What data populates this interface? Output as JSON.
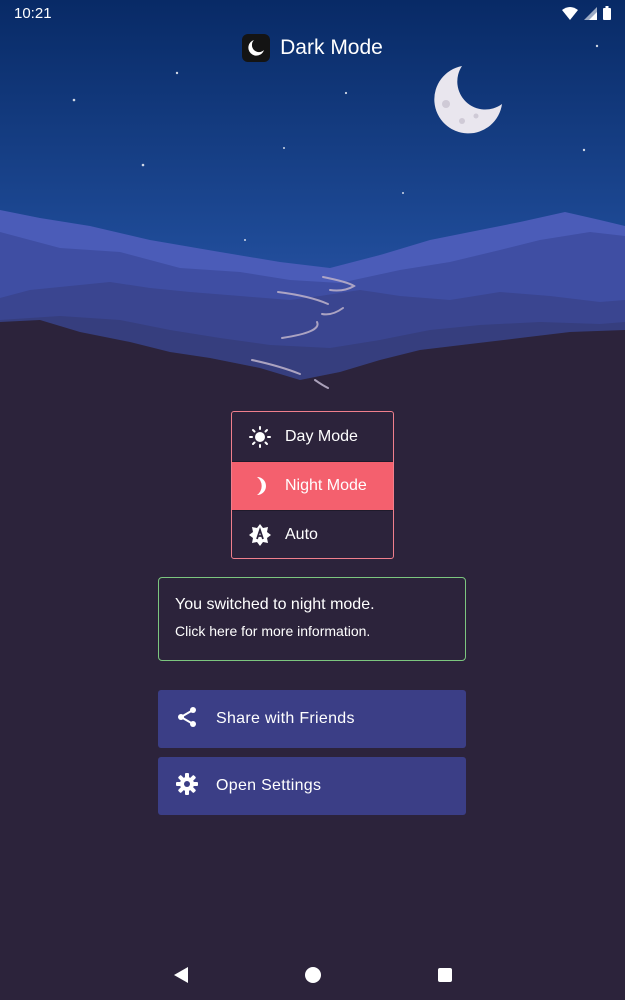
{
  "status_bar": {
    "time": "10:21",
    "icons": [
      "wifi-icon",
      "signal-icon",
      "battery-icon"
    ]
  },
  "header": {
    "title": "Dark Mode",
    "logo_icon": "crescent-moon-icon"
  },
  "mode_menu": {
    "items": [
      {
        "label": "Day Mode",
        "icon": "sun-icon",
        "selected": false
      },
      {
        "label": "Night Mode",
        "icon": "crescent-moon-icon",
        "selected": true
      },
      {
        "label": "Auto",
        "icon": "auto-brightness-icon",
        "selected": false
      }
    ]
  },
  "info_card": {
    "title": "You switched to night mode.",
    "subtitle": "Click here for more information."
  },
  "actions": {
    "share_label": "Share with Friends",
    "share_icon": "share-icon",
    "settings_label": "Open Settings",
    "settings_icon": "gear-icon"
  },
  "nav_bar": {
    "icons": [
      "back-icon",
      "home-icon",
      "recents-icon"
    ]
  },
  "colors": {
    "background": "#2c233b",
    "sky_top": "#0b2d6d",
    "selected_item": "#f4606e",
    "menu_border": "#f07f8c",
    "card_border": "#7cc67f",
    "button": "#3b3e86"
  }
}
